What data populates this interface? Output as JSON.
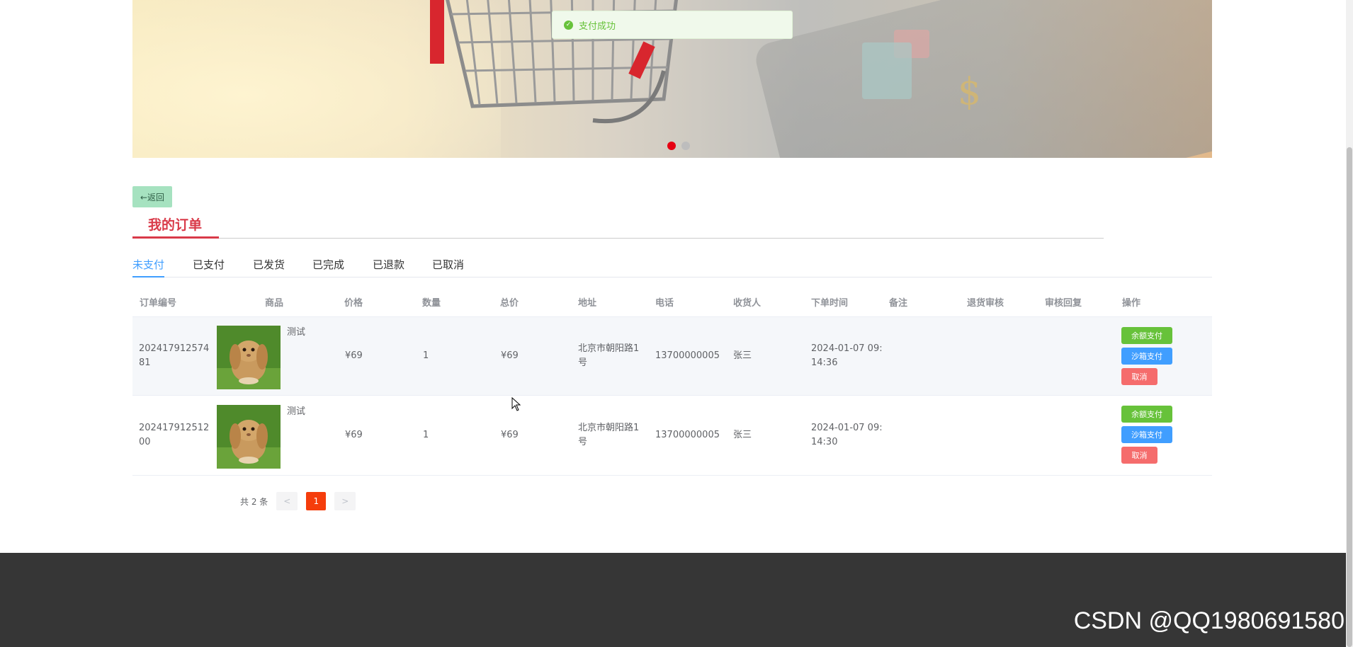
{
  "notification": {
    "message": "支付成功"
  },
  "nav": {
    "back_label": "←返回"
  },
  "page": {
    "title": "我的订单"
  },
  "tabs": [
    {
      "label": "未支付",
      "active": true
    },
    {
      "label": "已支付"
    },
    {
      "label": "已发货"
    },
    {
      "label": "已完成"
    },
    {
      "label": "已退款"
    },
    {
      "label": "已取消"
    }
  ],
  "table": {
    "columns": [
      "订单编号",
      "商品",
      "价格",
      "数量",
      "总价",
      "地址",
      "电话",
      "收货人",
      "下单时间",
      "备注",
      "退货审核",
      "审核回复",
      "操作"
    ],
    "rows": [
      {
        "order_no_line1": "202417912574",
        "order_no_line2": "81",
        "product_name": "测试",
        "product_icon": "rabbit-photo",
        "price": "¥69",
        "quantity": "1",
        "total": "¥69",
        "address_line1": "北京市朝阳路1",
        "address_line2": "号",
        "phone": "13700000005",
        "receiver": "张三",
        "time_line1": "2024-01-07 09:",
        "time_line2": "14:36",
        "remark": "",
        "return_review": "",
        "review_reply": "",
        "actions": {
          "balance_pay": "余额支付",
          "sandbox_pay": "沙箱支付",
          "cancel": "取消"
        }
      },
      {
        "order_no_line1": "202417912512",
        "order_no_line2": "00",
        "product_name": "测试",
        "product_icon": "rabbit-photo",
        "price": "¥69",
        "quantity": "1",
        "total": "¥69",
        "address_line1": "北京市朝阳路1",
        "address_line2": "号",
        "phone": "13700000005",
        "receiver": "张三",
        "time_line1": "2024-01-07 09:",
        "time_line2": "14:30",
        "remark": "",
        "return_review": "",
        "review_reply": "",
        "actions": {
          "balance_pay": "余额支付",
          "sandbox_pay": "沙箱支付",
          "cancel": "取消"
        }
      }
    ]
  },
  "pagination": {
    "total_label": "共 2 条",
    "prev": "<",
    "current": "1",
    "next": ">"
  },
  "watermark": {
    "text": "CSDN @QQ1980691580"
  },
  "colors": {
    "accent_red": "#d93a49",
    "tab_active": "#409eff",
    "success": "#67c23a",
    "danger": "#f56c6c",
    "page_current": "#f53d0c",
    "footer": "#363636"
  }
}
